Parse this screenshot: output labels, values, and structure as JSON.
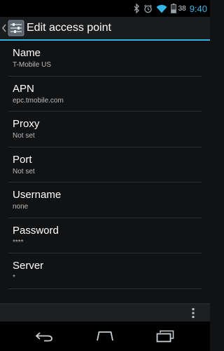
{
  "status_bar": {
    "battery_level": "38",
    "time": "9:40"
  },
  "action_bar": {
    "title": "Edit access point"
  },
  "preferences": [
    {
      "title": "Name",
      "summary": "T-Mobile US"
    },
    {
      "title": "APN",
      "summary": "epc.tmobile.com"
    },
    {
      "title": "Proxy",
      "summary": "Not set"
    },
    {
      "title": "Port",
      "summary": "Not set"
    },
    {
      "title": "Username",
      "summary": "none"
    },
    {
      "title": "Password",
      "summary": "****"
    },
    {
      "title": "Server",
      "summary": "*"
    }
  ],
  "colors": {
    "accent": "#33b5e5",
    "background": "#111214",
    "divider": "#2c2e31"
  },
  "icons": {
    "status": [
      "bluetooth-icon",
      "alarm-icon",
      "wifi-icon",
      "battery-icon"
    ],
    "nav": [
      "back-icon",
      "home-icon",
      "recent-apps-icon"
    ],
    "overflow": "overflow-menu-icon"
  }
}
